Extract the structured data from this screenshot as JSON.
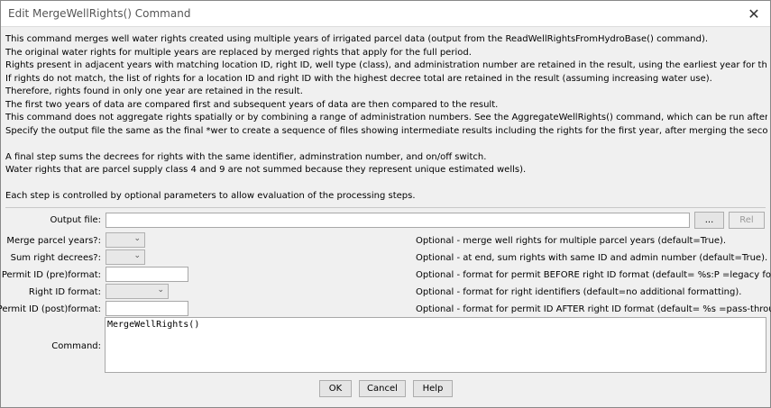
{
  "window": {
    "title": "Edit MergeWellRights() Command",
    "close_icon": "close-icon"
  },
  "description": [
    "This command merges well water rights created using multiple years of irrigated parcel data (output from the ReadWellRightsFromHydroBase() command).",
    "The original water rights for multiple years are replaced by merged rights that apply for the full period.",
    "Rights present in adjacent years with matching location ID, right ID, well type (class), and administration number are retained in the result, using the earliest year for the parcel year.",
    "If rights do not match, the list of rights for a location ID and right ID with the highest decree total are retained in the result (assuming increasing water use).",
    "Therefore, rights found in only one year are retained in the result.",
    "The first two years of data are compared first and subsequent years of data are then compared to the result.",
    "This command does not aggregate rights spatially or by combining a range of administration numbers.  See the AggregateWellRights() command, which can be run after this command.",
    "Specify the output file the same as the final *wer to create a sequence of files showing intermediate results including the rights for the first year, after merging the second year, etc.",
    "",
    "A final step sums the decrees for rights with the same identifier, adminstration number, and on/off switch.",
    "Water rights that are parcel supply class 4 and 9 are not summed because they represent unique estimated wells).",
    "",
    "Each step is controlled by optional parameters to allow evaluation of the processing steps."
  ],
  "form": {
    "output_file": {
      "label": "Output file:",
      "value": "",
      "browse": "...",
      "rel": "Rel"
    },
    "merge_parcel_years": {
      "label": "Merge parcel years?:",
      "value": "",
      "help": "Optional - merge well rights for multiple parcel years (default=True)."
    },
    "sum_right_decrees": {
      "label": "Sum right decrees?:",
      "value": "",
      "help": "Optional - at end, sum rights with same ID and admin number (default=True)."
    },
    "permit_id_pre_format": {
      "label": "Permit ID (pre)format:",
      "value": "",
      "help": "Optional - format for permit BEFORE right ID format (default= %s:P =legacy format)."
    },
    "right_id_format": {
      "label": "Right ID format:",
      "value": "",
      "help": "Optional - format for right identifiers (default=no additional formatting)."
    },
    "permit_id_post_format": {
      "label": "Permit ID (post)format:",
      "value": "",
      "help": "Optional - format for permit ID AFTER right ID format (default= %s =pass-through)."
    },
    "command": {
      "label": "Command:",
      "value": "MergeWellRights()"
    }
  },
  "buttons": {
    "ok": "OK",
    "cancel": "Cancel",
    "help": "Help"
  }
}
